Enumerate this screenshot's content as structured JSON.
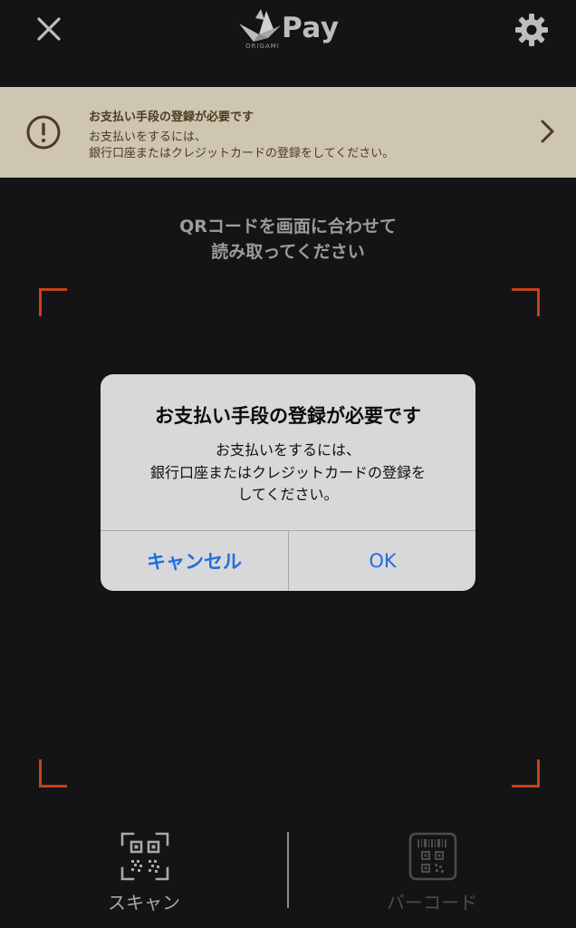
{
  "header": {
    "logo_text": "Pay",
    "logo_subtext": "ORIGAMI"
  },
  "banner": {
    "title": "お支払い手段の登録が必要です",
    "line1": "お支払いをするには、",
    "line2": "銀行口座またはクレジットカードの登録をしてください。"
  },
  "scan": {
    "instruction_line1": "QRコードを画面に合わせて",
    "instruction_line2": "読み取ってください"
  },
  "alert": {
    "title": "お支払い手段の登録が必要です",
    "message_line1": "お支払いをするには、",
    "message_line2": "銀行口座またはクレジットカードの登録を",
    "message_line3": "してください。",
    "cancel_label": "キャンセル",
    "ok_label": "OK"
  },
  "toolbar": {
    "scan_label": "スキャン",
    "barcode_label": "バーコード"
  },
  "colors": {
    "background": "#141416",
    "banner": "#cec6af",
    "accent_corner": "#c4421c",
    "alert_button": "#1f6fde"
  },
  "icons": [
    "close-icon",
    "crane-logo-icon",
    "gear-icon",
    "warning-icon",
    "chevron-right-icon",
    "qr-scan-icon",
    "barcode-icon"
  ]
}
